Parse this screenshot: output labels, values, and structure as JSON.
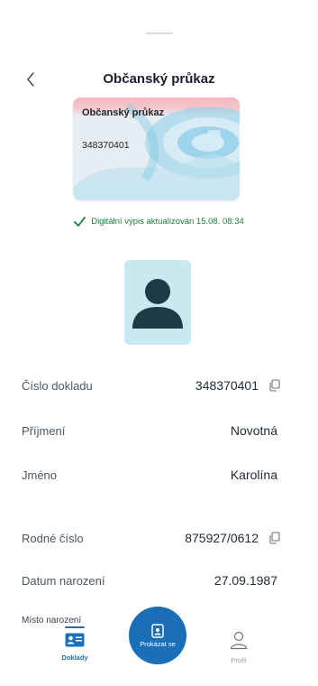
{
  "header": {
    "title": "Občanský průkaz",
    "back_icon": "chevron-left-icon"
  },
  "card": {
    "title": "Občanský průkaz",
    "number": "348370401"
  },
  "status": {
    "text": "Digitální výpis aktualizován 15.08. 08:34",
    "icon": "checkmark-icon",
    "color": "#1f7a35"
  },
  "avatar": {
    "icon": "person-silhouette-icon",
    "background": "#c9e9f0",
    "icon_color": "#1d3a47"
  },
  "fields": [
    {
      "label": "Číslo dokladu",
      "value": "348370401",
      "copyable": true
    },
    {
      "label": "Příjmení",
      "value": "Novotná",
      "copyable": false
    },
    {
      "label": "Jméno",
      "value": "Karolína",
      "copyable": false
    },
    {
      "label": "Rodné číslo",
      "value": "875927/0612",
      "copyable": true
    },
    {
      "label": "Datum narození",
      "value": "27.09.1987",
      "copyable": false
    }
  ],
  "birthplace_label": "Místo narození",
  "nav": {
    "documents_label": "Doklady",
    "show_label": "Prokázat se",
    "profile_label": "Profil",
    "accent": "#1b6fb8"
  }
}
